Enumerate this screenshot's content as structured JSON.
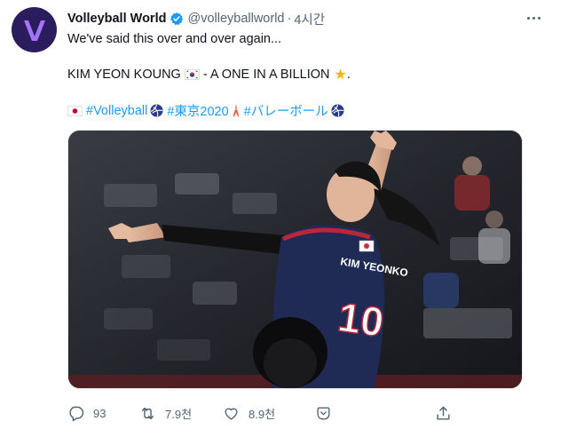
{
  "account": {
    "display_name": "Volleyball World",
    "handle": "@volleyballworld",
    "separator": "·",
    "time": "4시간"
  },
  "tweet": {
    "line1": "We've said this over and over again...",
    "line2_prefix": "KIM YEON KOUNG",
    "line2_suffix": "- A ONE IN A BILLION",
    "line2_end": ".",
    "hashtags": [
      "#Volleyball",
      "#東京2020",
      "#バレーボール"
    ]
  },
  "media": {
    "jersey_name": "KIM YEONKO",
    "jersey_number": "10"
  },
  "actions": {
    "replies": "93",
    "retweets": "7.9천",
    "likes": "8.9천"
  },
  "colors": {
    "link": "#1d9bf0",
    "verified": "#1d9bf0",
    "avatar_bg": "#2b1c5e",
    "jersey": "#1f2a55"
  },
  "icons": [
    "verified-badge-icon",
    "more-icon",
    "japan-flag-icon",
    "korea-flag-icon",
    "star-icon",
    "volleyball-icon",
    "tokyo-tower-icon",
    "reply-icon",
    "retweet-icon",
    "like-icon",
    "share-icon",
    "upload-icon"
  ]
}
